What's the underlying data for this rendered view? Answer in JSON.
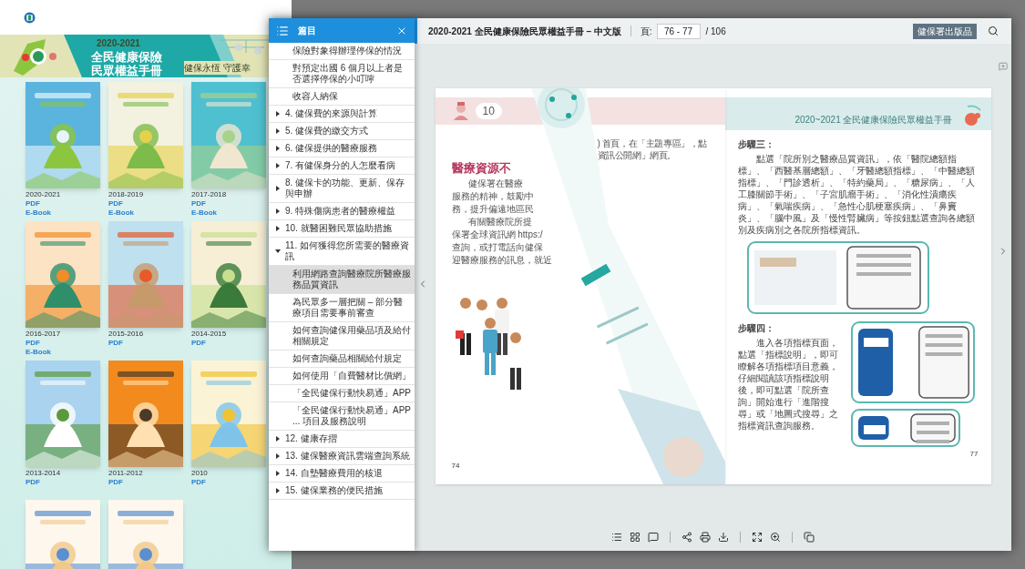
{
  "gallery": {
    "banner": {
      "year": "2020-2021",
      "title_lines": [
        "全民健康保險",
        "民眾權益手冊"
      ],
      "slogan": "健保永恆 守護幸"
    },
    "covers": [
      {
        "kind": "picture",
        "year": "2020-2021",
        "links": [
          "PDF",
          "E-Book"
        ]
      },
      {
        "kind": "picture",
        "year": "2018-2019",
        "links": [
          "PDF",
          "E-Book"
        ]
      },
      {
        "kind": "picture",
        "year": "2017-2018",
        "links": [
          "PDF",
          "E-Book"
        ]
      },
      {
        "kind": "picture",
        "year": "2016-2017",
        "links": [
          "PDF",
          "E-Book"
        ]
      },
      {
        "kind": "picture",
        "year": "2015-2016",
        "links": [
          "PDF"
        ]
      },
      {
        "kind": "picture",
        "year": "2014-2015",
        "links": [
          "PDF"
        ]
      },
      {
        "kind": "picture",
        "year": "2013-2014",
        "links": [
          "PDF"
        ]
      },
      {
        "kind": "picture",
        "year": "2011-2012",
        "links": [
          "PDF"
        ]
      },
      {
        "kind": "picture",
        "year": "2010",
        "links": [
          "PDF"
        ]
      },
      {
        "kind": "picture"
      },
      {
        "kind": "picture"
      }
    ]
  },
  "toc": {
    "title": "篇目",
    "leading_items": [
      {
        "label": "保險對象得辦理停保的情況",
        "selected": false
      },
      {
        "label": "對預定出國 6 個月以上者是否選擇停保的小叮嚀",
        "selected": false
      },
      {
        "label": "收容人納保",
        "selected": false
      }
    ],
    "chapters": [
      {
        "label": "4. 健保費的來源與計算",
        "expanded": false
      },
      {
        "label": "5. 健保費的繳交方式",
        "expanded": false
      },
      {
        "label": "6. 健保提供的醫療服務",
        "expanded": false
      },
      {
        "label": "7. 有健保身分的人怎麼看病",
        "expanded": false
      },
      {
        "label": "8. 健保卡的功能、更新、保存與申辦",
        "expanded": false
      },
      {
        "label": "9. 特殊傷病患者的醫療權益",
        "expanded": false
      },
      {
        "label": "10. 就醫困難民眾協助措施",
        "expanded": false
      },
      {
        "label": "11. 如何獲得您所需要的醫療資訊",
        "expanded": true,
        "children": [
          {
            "label": "利用網路查詢醫療院所醫療服務品質資訊",
            "selected": true
          },
          {
            "label": "為民眾多一層把關 – 部分醫療項目需要事前審查",
            "selected": false
          },
          {
            "label": "如何查詢健保用藥品項及給付相關規定",
            "selected": false
          },
          {
            "label": "如何查詢藥品相關給付規定",
            "selected": false
          },
          {
            "label": "如何使用「自費醫材比價網」",
            "selected": false
          },
          {
            "label": "「全民健保行動快易通」APP",
            "selected": false
          },
          {
            "label": "「全民健保行動快易通」APP ... 項目及服務說明",
            "selected": false
          }
        ]
      },
      {
        "label": "12. 健康存摺",
        "expanded": false
      },
      {
        "label": "13. 健保醫療資訊雲端查詢系統",
        "expanded": false
      },
      {
        "label": "14. 自墊醫療費用的核退",
        "expanded": false
      },
      {
        "label": "15. 健保業務的便民措施",
        "expanded": false
      }
    ]
  },
  "viewer": {
    "title": "2020-2021 全民健康保險民眾權益手冊 – 中文版",
    "page_label": "頁:",
    "page_value": "76 - 77",
    "page_total": "/ 106",
    "publications_button": "健保署出版品",
    "left_page": {
      "chapter_number": "10",
      "heading": "醫療資源不",
      "lines": [
        "健保署在醫療",
        "服務的精神，鼓勵中",
        "務，提升偏遠地區民",
        "有關醫療院所提",
        "保署全球資訊網 https:/",
        "查詢，或打電話向健保",
        "迎醫療服務的訊息，就近"
      ],
      "right_lines": [
        ") 首頁，在「主題專區」，點",
        "資訊公開網」網頁。"
      ],
      "page_number": "74"
    },
    "right_page": {
      "header": "2020~2021 全民健康保險民眾權益手冊",
      "step3_title": "步驟三：",
      "step3_text": "點選「院所別之醫療品質資訊」，依「醫院總額指標」、「西醫基層總額」、「牙醫總額指標」、「中醫總額指標」、「門診透析」、「特約藥局」、「糖尿病」、「人工膝關節手術」、「子宮肌瘤手術」、「消化性潰瘍疾病」、「氣喘疾病」、「急性心肌梗塞疾病」、「鼻竇炎」、「腦中風」及「慢性腎臟病」等按鈕點選查詢各總額別及疾病別之各院所指標資訊。",
      "step4_title": "步驟四：",
      "step4_text": "進入各項指標頁面，點選「指標說明」，即可瞭解各項指標項目意義，仔細閱讀該項指標說明後，即可點選「院所查詢」開始進行「進階搜尋」或「地圖式搜尋」之指標資訊查詢服務。",
      "page_number": "77"
    }
  }
}
